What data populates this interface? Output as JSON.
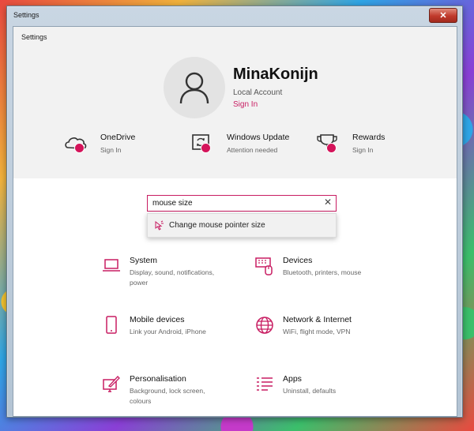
{
  "window": {
    "title": "Settings"
  },
  "app": {
    "title": "Settings"
  },
  "account": {
    "name": "MinaKonijn",
    "type": "Local Account",
    "signin": "Sign In"
  },
  "services": [
    {
      "name": "OneDrive",
      "status": "Sign In",
      "icon": "cloud-icon"
    },
    {
      "name": "Windows Update",
      "status": "Attention needed",
      "icon": "update-icon"
    },
    {
      "name": "Rewards",
      "status": "Sign In",
      "icon": "trophy-icon"
    }
  ],
  "search": {
    "value": "mouse size",
    "placeholder": ""
  },
  "suggestion": {
    "label": "Change mouse pointer size",
    "icon": "mouse-pointer-icon"
  },
  "categories": [
    {
      "name": "System",
      "desc": "Display, sound, notifications, power",
      "icon": "laptop-icon"
    },
    {
      "name": "Devices",
      "desc": "Bluetooth, printers, mouse",
      "icon": "devices-icon"
    },
    {
      "name": "Mobile devices",
      "desc": "Link your Android, iPhone",
      "icon": "phone-icon"
    },
    {
      "name": "Network & Internet",
      "desc": "WiFi, flight mode, VPN",
      "icon": "globe-icon"
    },
    {
      "name": "Personalisation",
      "desc": "Background, lock screen, colours",
      "icon": "paint-icon"
    },
    {
      "name": "Apps",
      "desc": "Uninstall, defaults",
      "icon": "apps-list-icon"
    }
  ],
  "colors": {
    "accent": "#c81d62",
    "badge": "#d4145a",
    "header_bg": "#f2f2f2"
  }
}
